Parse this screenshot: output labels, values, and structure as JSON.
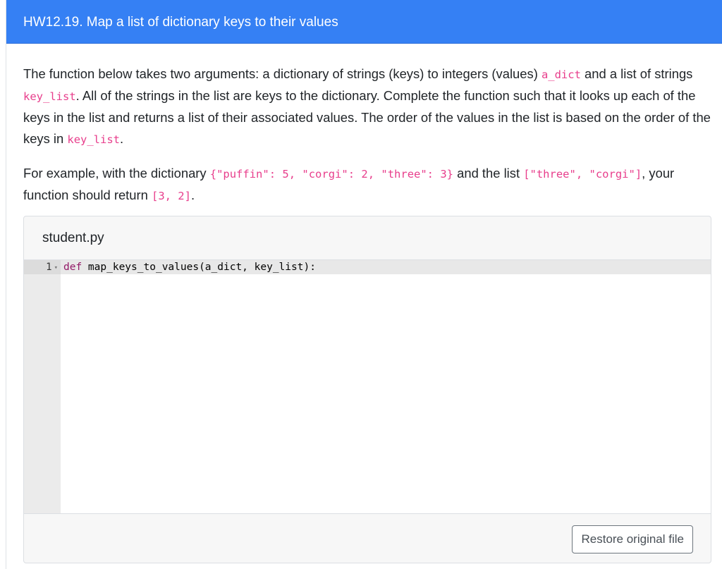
{
  "header": {
    "title": "HW12.19. Map a list of dictionary keys to their values"
  },
  "prose": {
    "p1": {
      "t1": "The function below takes two arguments: a dictionary of strings (keys) to integers (values) ",
      "c1": "a_dict",
      "t2": " and a list of strings ",
      "c2": "key_list",
      "t3": ". All of the strings in the list are keys to the dictionary. Complete the function such that it looks up each of the keys in the list and returns a list of their associated values. The order of the values in the list is based on the order of the keys in ",
      "c3": "key_list",
      "t4": "."
    },
    "p2": {
      "t1": "For example, with the dictionary ",
      "c1": "{\"puffin\": 5, \"corgi\": 2, \"three\": 3}",
      "t2": " and the list ",
      "c2": "[\"three\", \"corgi\"]",
      "t3": ", your function should return ",
      "c3": "[3, 2]",
      "t4": "."
    }
  },
  "editor": {
    "filename": "student.py",
    "lines": [
      {
        "number": "1",
        "keyword": "def",
        "rest": " map_keys_to_values(a_dict, key_list):"
      }
    ]
  },
  "footer": {
    "restore_label": "Restore original file"
  }
}
